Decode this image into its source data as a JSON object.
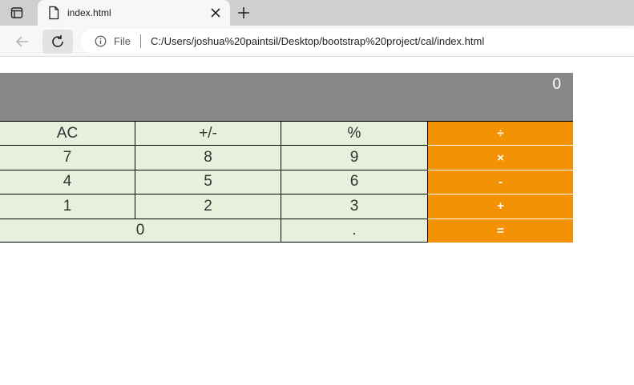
{
  "browser": {
    "tab_title": "index.html",
    "address_scheme": "File",
    "url": "C:/Users/joshua%20paintsil/Desktop/bootstrap%20project/cal/index.html"
  },
  "calculator": {
    "display": "0",
    "rows": [
      [
        {
          "label": "AC"
        },
        {
          "label": "+/-"
        },
        {
          "label": "%"
        },
        {
          "label": "÷"
        }
      ],
      [
        {
          "label": "7"
        },
        {
          "label": "8"
        },
        {
          "label": "9"
        },
        {
          "label": "×"
        }
      ],
      [
        {
          "label": "4"
        },
        {
          "label": "5"
        },
        {
          "label": "6"
        },
        {
          "label": "-"
        }
      ],
      [
        {
          "label": "1"
        },
        {
          "label": "2"
        },
        {
          "label": "3"
        },
        {
          "label": "+"
        }
      ],
      [
        {
          "label": "0"
        },
        {
          "label": "."
        },
        {
          "label": "="
        }
      ]
    ]
  },
  "colors": {
    "display_bg": "#888888",
    "key_bg": "#e6f0dc",
    "operator_bg": "#f39205"
  }
}
